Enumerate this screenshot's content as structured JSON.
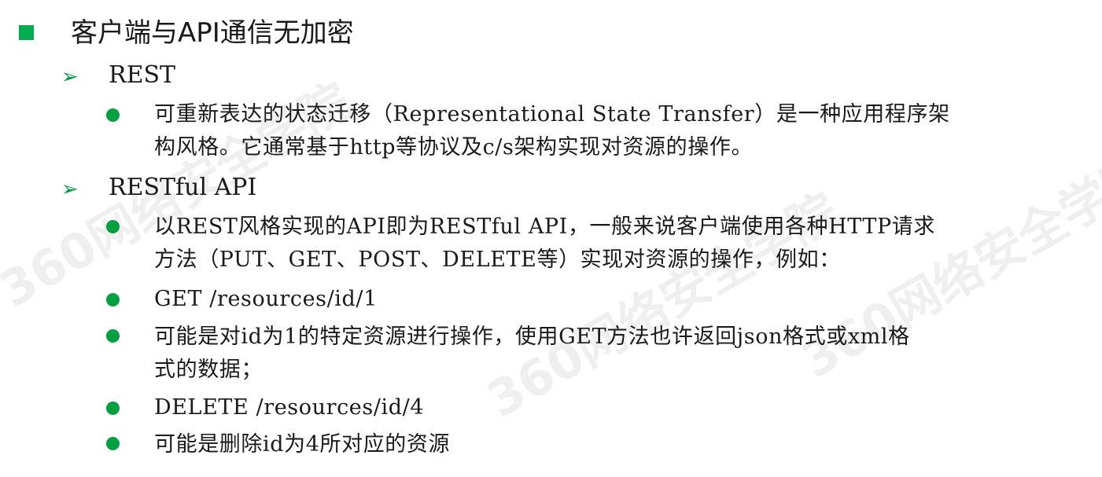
{
  "watermark": {
    "text": "360网络安全学院"
  },
  "heading": {
    "title": "客户端与API通信无加密"
  },
  "sections": [
    {
      "title": "REST",
      "bullets": [
        {
          "lines": [
            "可重新表达的状态迁移（Representational State Transfer）是一种应用程序架",
            "构风格。它通常基于http等协议及c/s架构实现对资源的操作。"
          ]
        }
      ]
    },
    {
      "title": "RESTful API",
      "bullets": [
        {
          "lines": [
            "以REST风格实现的API即为RESTful API，一般来说客户端使用各种HTTP请求",
            "方法（PUT、GET、POST、DELETE等）实现对资源的操作，例如："
          ]
        },
        {
          "lines": [
            "GET /resources/id/1"
          ]
        },
        {
          "lines": [
            "可能是对id为1的特定资源进行操作，使用GET方法也许返回json格式或xml格",
            "式的数据；"
          ]
        },
        {
          "lines": [
            "DELETE  /resources/id/4"
          ]
        },
        {
          "lines": [
            "可能是删除id为4所对应的资源"
          ]
        }
      ]
    }
  ]
}
